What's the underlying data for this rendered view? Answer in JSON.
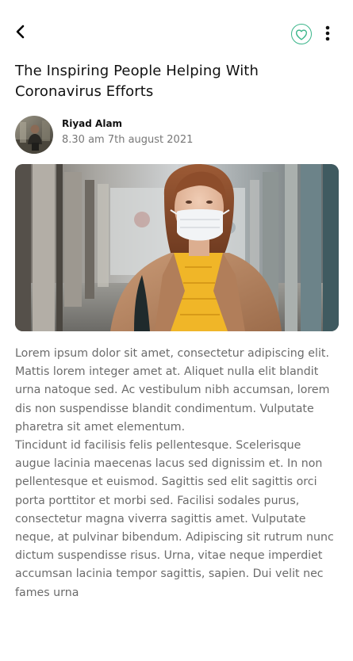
{
  "header": {
    "back_label": "Back",
    "favorite_label": "Favorite",
    "more_label": "More options",
    "accent_color": "#3ab58a"
  },
  "article": {
    "title": "The Inspiring People Helping With Coronavirus Efforts",
    "author": {
      "name": "Riyad Alam",
      "published": "8.30 am 7th august 2021"
    },
    "hero_image": {
      "icon": "photo-woman-in-mask"
    },
    "paragraphs": [
      "Lorem ipsum dolor sit amet, consectetur adipiscing elit. Mattis lorem integer amet at. Aliquet nulla elit blandit urna natoque sed. Ac vestibulum nibh accumsan, lorem dis non suspendisse blandit condimentum. Vulputate pharetra sit amet elementum.",
      "Tincidunt id facilisis felis pellentesque. Scelerisque augue lacinia maecenas lacus sed dignissim et. In non pellentesque et euismod. Sagittis sed elit sagittis orci porta porttitor et morbi sed. Facilisi sodales purus, consectetur magna viverra sagittis amet. Vulputate neque, at pulvinar bibendum. Adipiscing sit rutrum nunc dictum suspendisse risus. Urna, vitae neque imperdiet accumsan lacinia tempor sagittis, sapien. Dui velit nec fames urna"
    ]
  }
}
